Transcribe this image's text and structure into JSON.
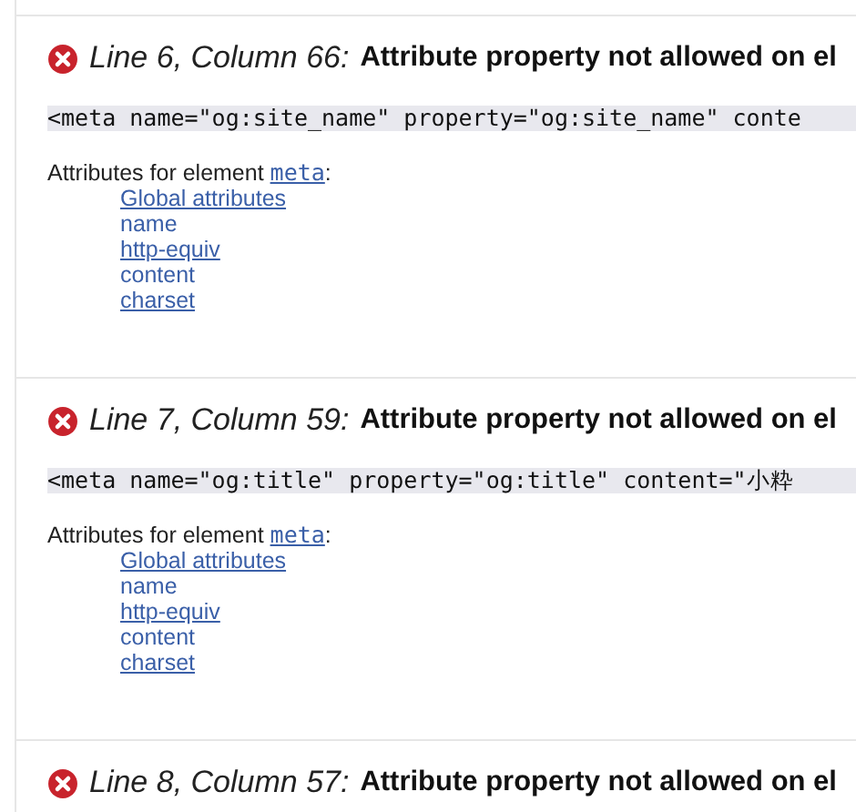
{
  "messages": [
    {
      "location": "Line 6, Column 66:",
      "message": "Attribute property not allowed on el",
      "code": "<meta name=\"og:site_name\" property=\"og:site_name\" conte",
      "attributes_label": "Attributes for element",
      "element": "meta",
      "element_suffix": ":",
      "attributes": [
        {
          "label": "Global attributes",
          "link": true
        },
        {
          "label": "name",
          "link": false
        },
        {
          "label": "http-equiv",
          "link": true
        },
        {
          "label": "content",
          "link": false
        },
        {
          "label": "charset",
          "link": true
        }
      ]
    },
    {
      "location": "Line 7, Column 59:",
      "message": "Attribute property not allowed on el",
      "code": "<meta name=\"og:title\" property=\"og:title\" content=\"小粋",
      "attributes_label": "Attributes for element",
      "element": "meta",
      "element_suffix": ":",
      "attributes": [
        {
          "label": "Global attributes",
          "link": true
        },
        {
          "label": "name",
          "link": false
        },
        {
          "label": "http-equiv",
          "link": true
        },
        {
          "label": "content",
          "link": false
        },
        {
          "label": "charset",
          "link": true
        }
      ]
    },
    {
      "location": "Line 8, Column 57:",
      "message": "Attribute property not allowed on el"
    }
  ]
}
